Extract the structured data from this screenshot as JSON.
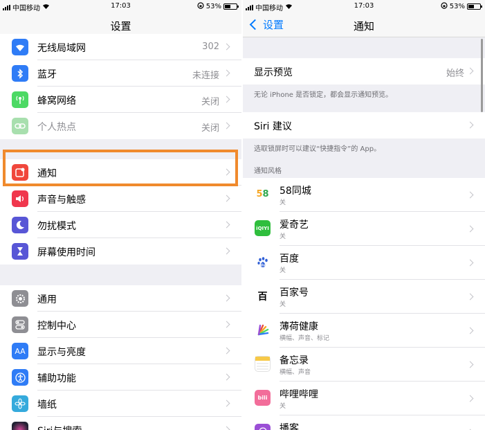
{
  "left": {
    "status": {
      "carrier": "中国移动",
      "time": "17:03",
      "battery": "53%",
      "battery_level": 0.53
    },
    "nav_title": "设置",
    "groups": [
      {
        "items": [
          {
            "label": "无线局域网",
            "value": "302",
            "icon": "wifi-icon",
            "color": "#2f7cf6"
          },
          {
            "label": "蓝牙",
            "value": "未连接",
            "icon": "bluetooth-icon",
            "color": "#2f7cf6"
          },
          {
            "label": "蜂窝网络",
            "value": "关闭",
            "icon": "cellular-icon",
            "color": "#4cd964"
          },
          {
            "label": "个人热点",
            "value": "关闭",
            "icon": "hotspot-icon",
            "color": "#a8dfae"
          }
        ]
      },
      {
        "items": [
          {
            "label": "通知",
            "value": "",
            "icon": "notifications-icon",
            "color": "#f0473c"
          },
          {
            "label": "声音与触感",
            "value": "",
            "icon": "sound-icon",
            "color": "#f0374d"
          },
          {
            "label": "勿扰模式",
            "value": "",
            "icon": "moon-icon",
            "color": "#5856d6"
          },
          {
            "label": "屏幕使用时间",
            "value": "",
            "icon": "hourglass-icon",
            "color": "#5856d6"
          }
        ]
      },
      {
        "items": [
          {
            "label": "通用",
            "value": "",
            "icon": "gear-icon",
            "color": "#8e8e93"
          },
          {
            "label": "控制中心",
            "value": "",
            "icon": "toggles-icon",
            "color": "#8e8e93"
          },
          {
            "label": "显示与亮度",
            "value": "",
            "icon": "text-size-icon",
            "color": "#2f7cf6"
          },
          {
            "label": "辅助功能",
            "value": "",
            "icon": "accessibility-icon",
            "color": "#2f7cf6"
          },
          {
            "label": "墙纸",
            "value": "",
            "icon": "flower-icon",
            "color": "#35aadc"
          },
          {
            "label": "Siri与搜索",
            "value": "",
            "icon": "siri-icon",
            "color": "#222233"
          }
        ]
      }
    ]
  },
  "right": {
    "status": {
      "carrier": "中国移动",
      "time": "17:03",
      "battery": "53%",
      "battery_level": 0.53
    },
    "back_label": "设置",
    "nav_title": "通知",
    "preview": {
      "label": "显示预览",
      "value": "始终",
      "note": "无论 iPhone 是否锁定，都会显示通知预览。"
    },
    "siri": {
      "label": "Siri 建议",
      "note": "选取锁屏时可以建议“快捷指令”的 App。"
    },
    "section_header": "通知风格",
    "apps": [
      {
        "name": "58同城",
        "sub": "关",
        "icon": "58-tongcheng-icon",
        "color": "#ffffff",
        "glyph": "58"
      },
      {
        "name": "爱奇艺",
        "sub": "关",
        "icon": "iqiyi-icon",
        "color": "#2fbe3d",
        "glyph": "iQIYI"
      },
      {
        "name": "百度",
        "sub": "关",
        "icon": "baidu-icon",
        "color": "#ffffff",
        "glyph": "du"
      },
      {
        "name": "百家号",
        "sub": "关",
        "icon": "baijiahao-icon",
        "color": "#ffffff",
        "glyph": "百"
      },
      {
        "name": "薄荷健康",
        "sub": "横幅、声音、标记",
        "icon": "bohe-icon",
        "color": "#ffffff",
        "glyph": ""
      },
      {
        "name": "备忘录",
        "sub": "横幅、声音",
        "icon": "notes-icon",
        "color": "#ffffff",
        "glyph": ""
      },
      {
        "name": "哔哩哔哩",
        "sub": "关",
        "icon": "bilibili-icon",
        "color": "#f26d9a",
        "glyph": "bili"
      },
      {
        "name": "播客",
        "sub": "",
        "icon": "podcasts-icon",
        "color": "#9b4fd6",
        "glyph": ""
      }
    ]
  }
}
